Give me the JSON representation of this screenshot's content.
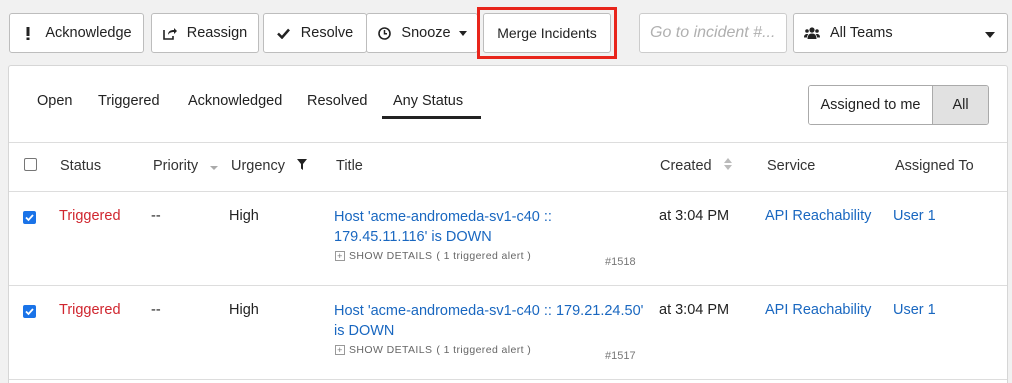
{
  "toolbar": {
    "acknowledge": "Acknowledge",
    "reassign": "Reassign",
    "resolve": "Resolve",
    "snooze": "Snooze",
    "merge": "Merge Incidents",
    "goto_placeholder": "Go to incident #...",
    "teams": "All Teams"
  },
  "tabs": [
    "Open",
    "Triggered",
    "Acknowledged",
    "Resolved",
    "Any Status"
  ],
  "active_tab": "Any Status",
  "assign_filter": {
    "me": "Assigned to me",
    "all": "All",
    "selected": "All"
  },
  "columns": {
    "status": "Status",
    "priority": "Priority",
    "urgency": "Urgency",
    "title": "Title",
    "created": "Created",
    "service": "Service",
    "assigned": "Assigned To"
  },
  "rows": [
    {
      "checked": true,
      "status": "Triggered",
      "priority": "--",
      "urgency": "High",
      "title": "Host 'acme-andromeda-sv1-c40 :: 179.45.11.116' is DOWN",
      "details": "SHOW DETAILS",
      "alerts": "( 1 triggered alert )",
      "number": "#1518",
      "created": "at 3:04 PM",
      "service": "API Reachability",
      "assigned": "User 1"
    },
    {
      "checked": true,
      "status": "Triggered",
      "priority": "--",
      "urgency": "High",
      "title": "Host 'acme-andromeda-sv1-c40 :: 179.21.24.50' is DOWN",
      "details": "SHOW DETAILS",
      "alerts": "( 1 triggered alert )",
      "number": "#1517",
      "created": "at 3:04 PM",
      "service": "API Reachability",
      "assigned": "User 1"
    }
  ],
  "colors": {
    "highlight": "#e8251b",
    "status_red": "#d0262f",
    "link_blue": "#1967c0",
    "checkbox_blue": "#1a73e8"
  }
}
